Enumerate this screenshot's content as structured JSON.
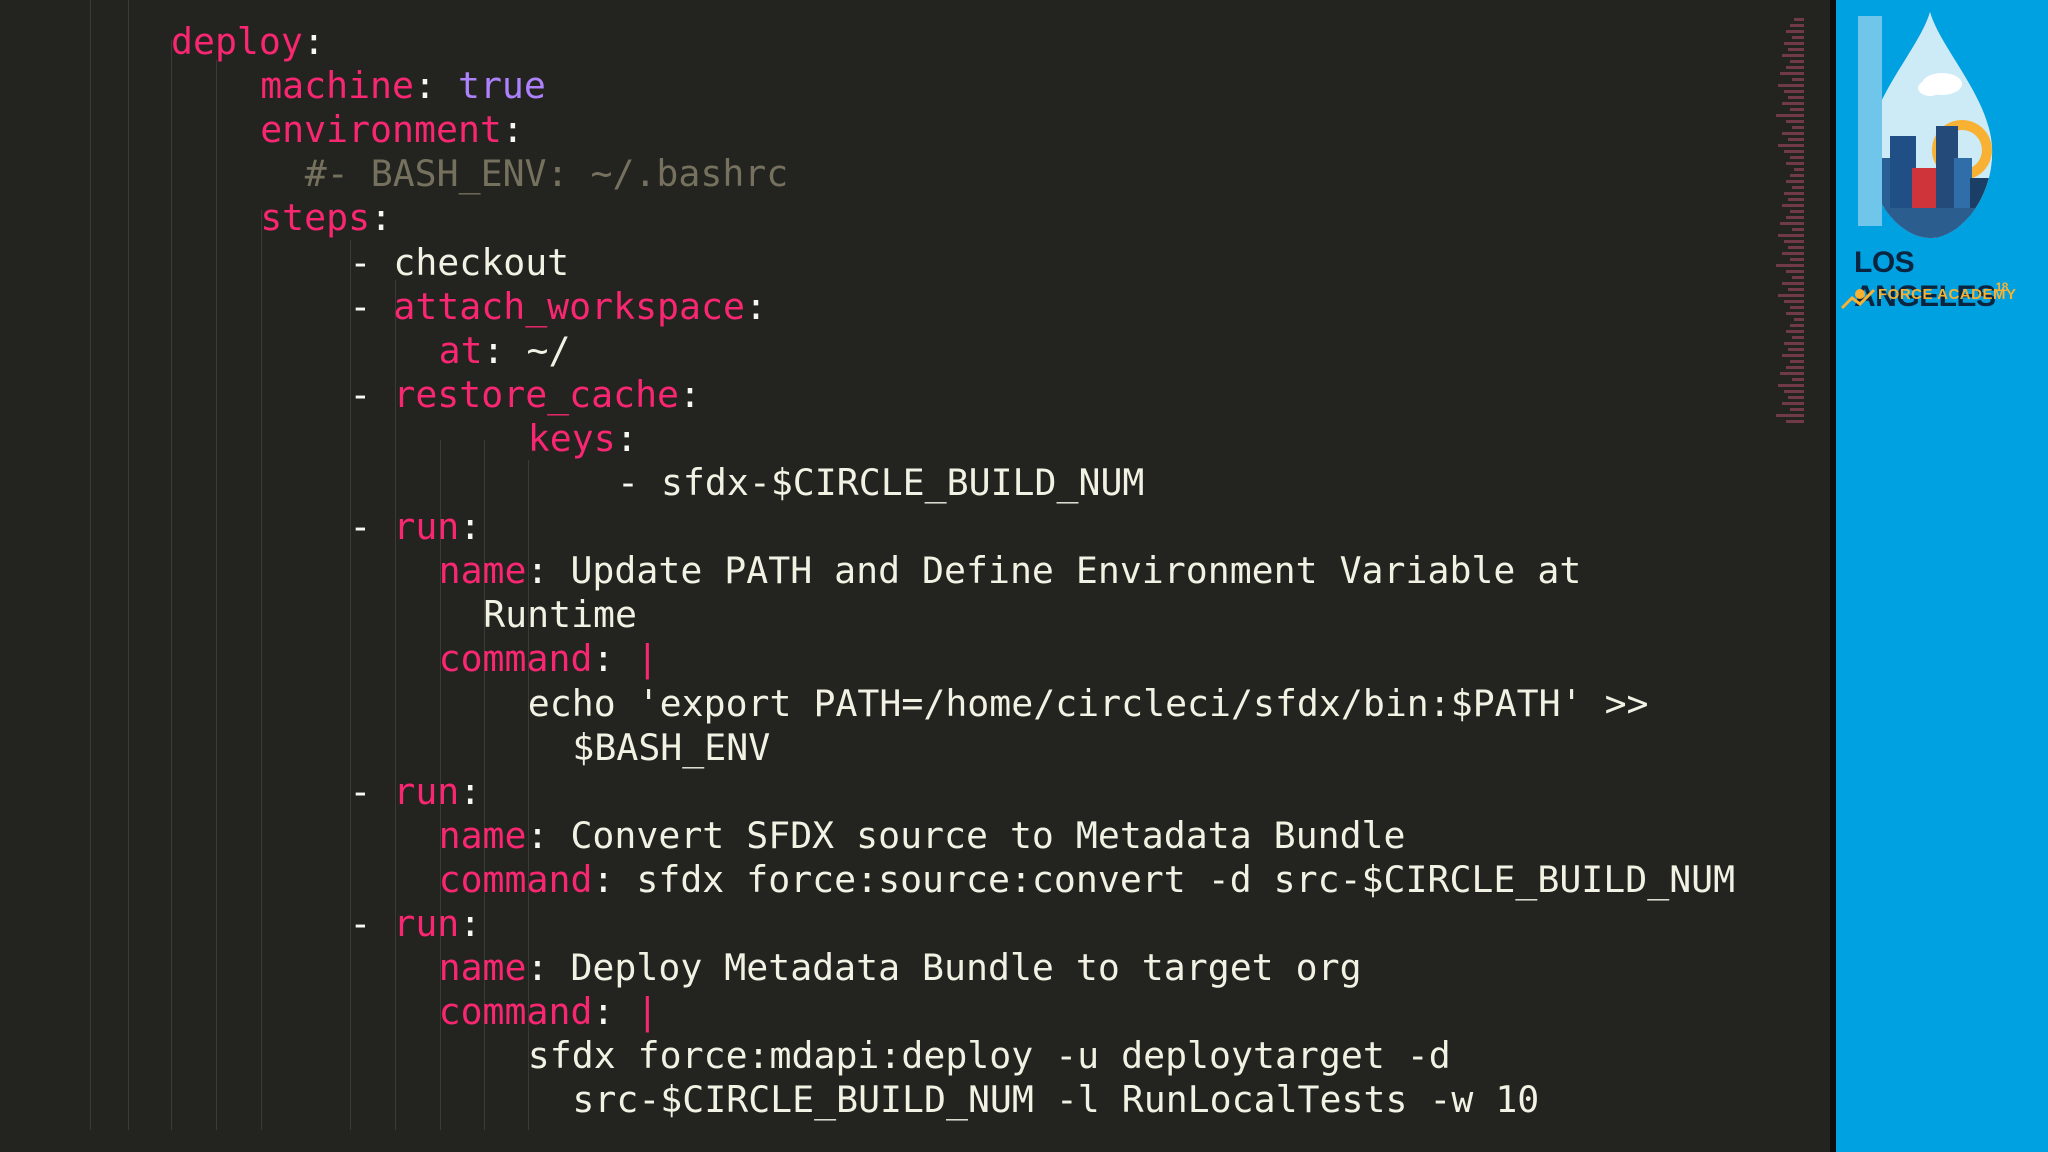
{
  "editor": {
    "lines": [
      {
        "indent": 0,
        "tokens": [
          {
            "t": "deploy",
            "c": "key"
          },
          {
            "t": ":",
            "c": "pun"
          }
        ]
      },
      {
        "indent": 2,
        "tokens": [
          {
            "t": "machine",
            "c": "key"
          },
          {
            "t": ": ",
            "c": "pun"
          },
          {
            "t": "true",
            "c": "bool"
          }
        ]
      },
      {
        "indent": 2,
        "tokens": [
          {
            "t": "environment",
            "c": "key"
          },
          {
            "t": ":",
            "c": "pun"
          }
        ]
      },
      {
        "indent": 3,
        "tokens": [
          {
            "t": "#- BASH_ENV: ~/.bashrc",
            "c": "com"
          }
        ]
      },
      {
        "indent": 2,
        "tokens": [
          {
            "t": "steps",
            "c": "key"
          },
          {
            "t": ":",
            "c": "pun"
          }
        ]
      },
      {
        "indent": 4,
        "tokens": [
          {
            "t": "- ",
            "c": "dash"
          },
          {
            "t": "checkout",
            "c": "str"
          }
        ]
      },
      {
        "indent": 4,
        "tokens": [
          {
            "t": "- ",
            "c": "dash"
          },
          {
            "t": "attach_workspace",
            "c": "key"
          },
          {
            "t": ":",
            "c": "pun"
          }
        ]
      },
      {
        "indent": 6,
        "tokens": [
          {
            "t": "at",
            "c": "key"
          },
          {
            "t": ": ",
            "c": "pun"
          },
          {
            "t": "~/",
            "c": "str"
          }
        ]
      },
      {
        "indent": 4,
        "tokens": [
          {
            "t": "- ",
            "c": "dash"
          },
          {
            "t": "restore_cache",
            "c": "key"
          },
          {
            "t": ":",
            "c": "pun"
          }
        ]
      },
      {
        "indent": 8,
        "tokens": [
          {
            "t": "keys",
            "c": "key"
          },
          {
            "t": ":",
            "c": "pun"
          }
        ]
      },
      {
        "indent": 10,
        "tokens": [
          {
            "t": "- ",
            "c": "dash"
          },
          {
            "t": "sfdx-$CIRCLE_BUILD_NUM",
            "c": "str"
          }
        ]
      },
      {
        "indent": 4,
        "tokens": [
          {
            "t": "- ",
            "c": "dash"
          },
          {
            "t": "run",
            "c": "key"
          },
          {
            "t": ":",
            "c": "pun"
          }
        ]
      },
      {
        "indent": 6,
        "tokens": [
          {
            "t": "name",
            "c": "key"
          },
          {
            "t": ": ",
            "c": "pun"
          },
          {
            "t": "Update PATH and Define Environment Variable at",
            "c": "str"
          }
        ]
      },
      {
        "indent": 7,
        "tokens": [
          {
            "t": "Runtime",
            "c": "str"
          }
        ]
      },
      {
        "indent": 6,
        "tokens": [
          {
            "t": "command",
            "c": "key"
          },
          {
            "t": ": ",
            "c": "pun"
          },
          {
            "t": "|",
            "c": "pipe"
          }
        ]
      },
      {
        "indent": 8,
        "tokens": [
          {
            "t": "echo 'export PATH=/home/circleci/sfdx/bin:$PATH' >>",
            "c": "str"
          }
        ]
      },
      {
        "indent": 9,
        "tokens": [
          {
            "t": "$BASH_ENV",
            "c": "str"
          }
        ]
      },
      {
        "indent": 4,
        "tokens": [
          {
            "t": "- ",
            "c": "dash"
          },
          {
            "t": "run",
            "c": "key"
          },
          {
            "t": ":",
            "c": "pun"
          }
        ]
      },
      {
        "indent": 6,
        "tokens": [
          {
            "t": "name",
            "c": "key"
          },
          {
            "t": ": ",
            "c": "pun"
          },
          {
            "t": "Convert SFDX source to Metadata Bundle",
            "c": "str"
          }
        ]
      },
      {
        "indent": 6,
        "tokens": [
          {
            "t": "command",
            "c": "key"
          },
          {
            "t": ": ",
            "c": "pun"
          },
          {
            "t": "sfdx force:source:convert -d src-$CIRCLE_BUILD_NUM",
            "c": "str"
          }
        ]
      },
      {
        "indent": 4,
        "tokens": [
          {
            "t": "- ",
            "c": "dash"
          },
          {
            "t": "run",
            "c": "key"
          },
          {
            "t": ":",
            "c": "pun"
          }
        ]
      },
      {
        "indent": 6,
        "tokens": [
          {
            "t": "name",
            "c": "key"
          },
          {
            "t": ": ",
            "c": "pun"
          },
          {
            "t": "Deploy Metadata Bundle to target org",
            "c": "str"
          }
        ]
      },
      {
        "indent": 6,
        "tokens": [
          {
            "t": "command",
            "c": "key"
          },
          {
            "t": ": ",
            "c": "pun"
          },
          {
            "t": "|",
            "c": "pipe"
          }
        ]
      },
      {
        "indent": 8,
        "tokens": [
          {
            "t": "sfdx force:mdapi:deploy -u deploytarget -d",
            "c": "str"
          }
        ]
      },
      {
        "indent": 9,
        "tokens": [
          {
            "t": "src-$CIRCLE_BUILD_NUM -l RunLocalTests -w 10",
            "c": "str"
          }
        ]
      }
    ]
  },
  "branding": {
    "line1": "LOS ANGELES",
    "superscript": "18",
    "line2": "FORCE ACADEMY"
  },
  "colors": {
    "editor_bg": "#23241f",
    "key": "#f92672",
    "bool": "#ae81ff",
    "comment": "#75715e",
    "text": "#f2f2e4",
    "sidebar_bg": "#00a1e0"
  }
}
